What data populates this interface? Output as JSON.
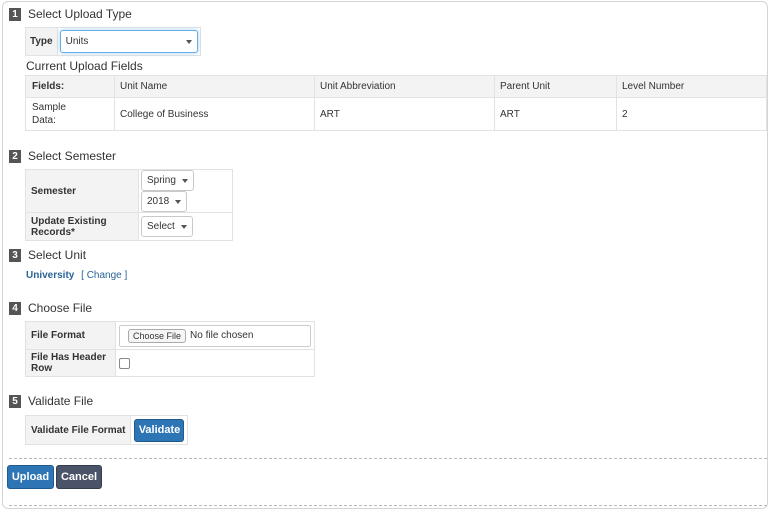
{
  "step1": {
    "number": "1",
    "title": "Select Upload Type",
    "type_label": "Type",
    "type_value": "Units",
    "fields_heading": "Current Upload Fields",
    "columns": [
      "Fields:",
      "Unit Name",
      "Unit Abbreviation",
      "Parent Unit",
      "Level Number"
    ],
    "sample_row": [
      "Sample Data:",
      "College of Business",
      "ART",
      "ART",
      "2"
    ]
  },
  "step2": {
    "number": "2",
    "title": "Select Semester",
    "semester_label": "Semester",
    "semester_value": "Spring",
    "year_value": "2018",
    "update_label": "Update Existing Records*",
    "update_value": "Select"
  },
  "step3": {
    "number": "3",
    "title": "Select Unit",
    "unit_name": "University",
    "change_link": "[ Change ]"
  },
  "step4": {
    "number": "4",
    "title": "Choose File",
    "format_label": "File Format",
    "choose_button": "Choose File",
    "no_file_text": "No file chosen",
    "header_row_label": "File Has Header Row",
    "header_row_checked": false
  },
  "step5": {
    "number": "5",
    "title": "Validate File",
    "validate_label": "Validate File Format",
    "validate_button": "Validate"
  },
  "actions": {
    "upload_button": "Upload",
    "cancel_button": "Cancel"
  },
  "colors": {
    "accent_blue": "#2e75b6",
    "link_blue": "#2a6496",
    "cancel_gray": "#4a5368"
  }
}
